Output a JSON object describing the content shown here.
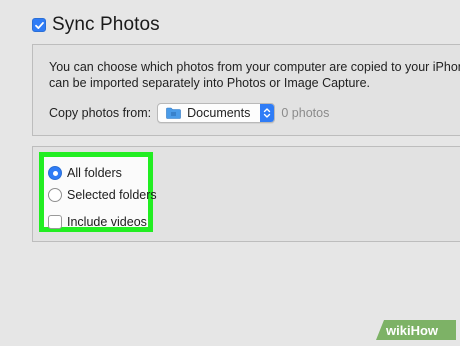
{
  "sync": {
    "checked": true,
    "title": "Sync Photos"
  },
  "info": {
    "line1": "You can choose which photos from your computer are copied to your iPhone",
    "line2": "can be imported separately into Photos or Image Capture.",
    "copy_label": "Copy photos from:",
    "source_icon": "folder-icon",
    "source_value": "Documents",
    "photo_count": "0 photos"
  },
  "options": {
    "all_folders": "All folders",
    "selected_folders": "Selected folders",
    "include_videos": "Include videos",
    "selected": "all_folders",
    "include_videos_checked": false
  },
  "colors": {
    "accent": "#2f7cf6",
    "highlight": "#22ee22",
    "panel_bg": "#e2e2e2",
    "page_bg": "#e6e6e6"
  },
  "watermark": {
    "text": "wikiHow"
  }
}
